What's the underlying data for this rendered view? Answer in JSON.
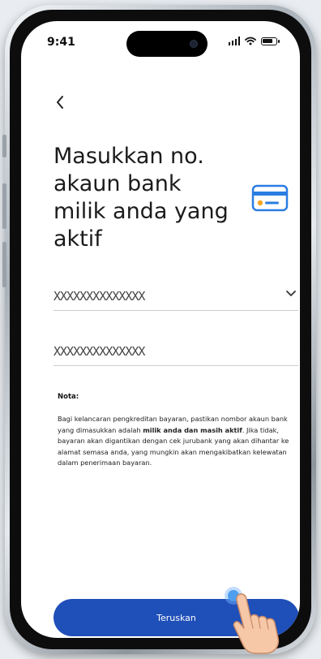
{
  "status_bar": {
    "time": "9:41"
  },
  "header": {
    "back_icon": "chevron-left-icon",
    "title": "Masukkan no. akaun bank milik anda yang aktif",
    "card_icon": "credit-card-icon"
  },
  "form": {
    "bank_select": {
      "value": "XXXXXXXXXXXXXX",
      "icon": "chevron-down-icon"
    },
    "account_number": {
      "value": "XXXXXXXXXXXXXX"
    }
  },
  "note": {
    "label": "Nota:",
    "text_1": "Bagi kelancaran pengkreditan bayaran, pastikan nombor akaun bank yang dimasukkan adalah ",
    "bold": "milik anda dan masih aktif",
    "text_2": ". Jika tidak, bayaran akan digantikan dengan cek jurubank yang akan dihantar ke alamat semasa anda, yang mungkin akan mengakibatkan kelewatan dalam penerimaan bayaran."
  },
  "cta": {
    "label": "Teruskan"
  },
  "colors": {
    "primary": "#1f4fb8",
    "card_icon": "#2a7de1",
    "card_chip": "#f5a623"
  }
}
